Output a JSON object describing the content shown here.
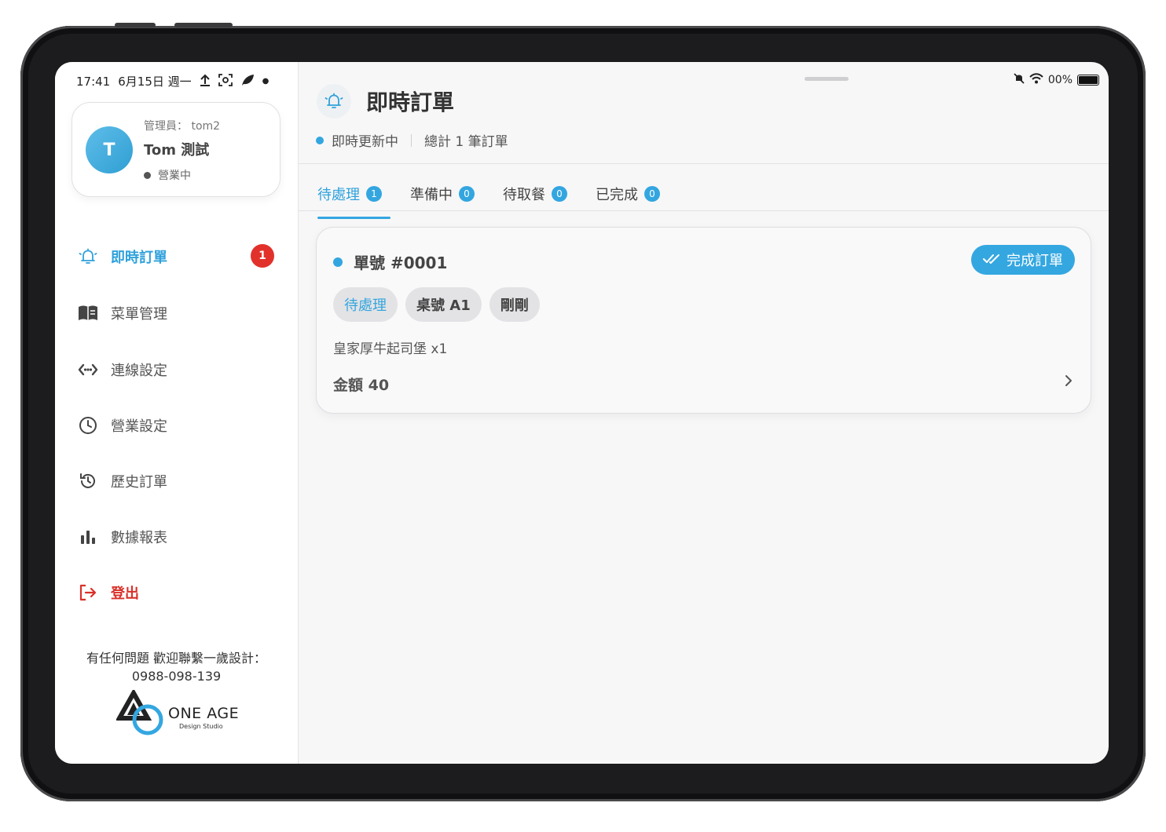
{
  "status_bar": {
    "time": "17:41",
    "date": "6月15日 週一",
    "battery": "00%"
  },
  "profile": {
    "avatar_letter": "T",
    "role": "管理員： tom2",
    "name": "Tom 測試",
    "status": "營業中"
  },
  "sidebar": {
    "items": [
      {
        "label": "即時訂單",
        "icon": "bell-icon",
        "badge": "1"
      },
      {
        "label": "菜單管理",
        "icon": "book-icon"
      },
      {
        "label": "連線設定",
        "icon": "link-icon"
      },
      {
        "label": "營業設定",
        "icon": "clock-icon"
      },
      {
        "label": "歷史訂單",
        "icon": "history-icon"
      },
      {
        "label": "數據報表",
        "icon": "bar-chart-icon"
      },
      {
        "label": "登出",
        "icon": "logout-icon"
      }
    ],
    "contact_line1": "有任何問題 歡迎聯繫一歲設計：",
    "contact_line2": "0988-098-139",
    "logo_name": "ONE AGE",
    "logo_sub": "Design Studio"
  },
  "header": {
    "title": "即時訂單",
    "live_status": "即時更新中",
    "total_text": "總計 1 筆訂單"
  },
  "tabs": [
    {
      "label": "待處理",
      "count": "1"
    },
    {
      "label": "準備中",
      "count": "0"
    },
    {
      "label": "待取餐",
      "count": "0"
    },
    {
      "label": "已完成",
      "count": "0"
    }
  ],
  "order": {
    "number": "單號 #0001",
    "complete_label": "完成訂單",
    "status_chip": "待處理",
    "table_chip": "桌號 A1",
    "time_chip": "剛剛",
    "item": "皇家厚牛起司堡 x1",
    "total": "金額 40"
  },
  "colors": {
    "accent": "#33a6e0",
    "danger": "#e2312b",
    "device_frame": "#1c1c1e"
  }
}
